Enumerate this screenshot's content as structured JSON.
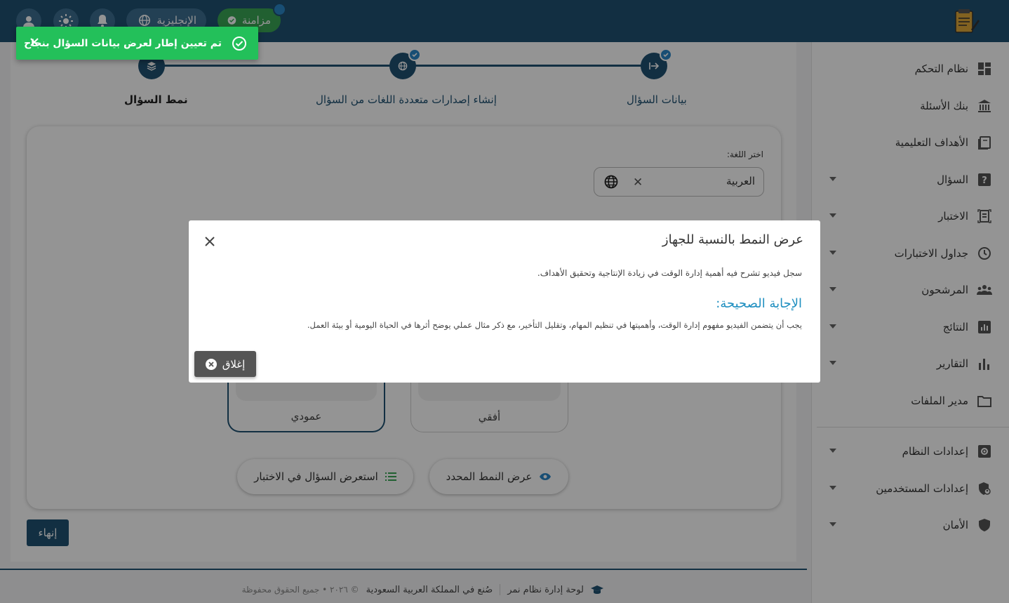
{
  "header": {
    "language_button": "الإنجليزية",
    "sync_button": "مزامنة"
  },
  "sidebar": {
    "items": [
      {
        "label": "نظام التحكم",
        "icon": "dashboard-icon"
      },
      {
        "label": "بنك الأسئلة",
        "icon": "bank-icon"
      },
      {
        "label": "الأهداف التعليمية",
        "icon": "book-icon"
      },
      {
        "label": "السؤال",
        "icon": "question-icon",
        "expandable": true
      },
      {
        "label": "الاختبار",
        "icon": "exam-icon",
        "expandable": true
      },
      {
        "label": "جداول الاختبارات",
        "icon": "clock-icon",
        "expandable": true
      },
      {
        "label": "المرشحون",
        "icon": "group-icon",
        "expandable": true
      },
      {
        "label": "النتائج",
        "icon": "results-icon",
        "expandable": true
      },
      {
        "label": "التقارير",
        "icon": "bar-chart-icon",
        "expandable": true
      },
      {
        "label": "مدير الملفات",
        "icon": "folder-icon"
      }
    ],
    "settings": [
      {
        "label": "إعدادات النظام",
        "icon": "settings-icon",
        "expandable": true
      },
      {
        "label": "إعدادات المستخدمين",
        "icon": "user-shield-icon",
        "expandable": true
      },
      {
        "label": "الأمان",
        "icon": "shield-icon",
        "expandable": true
      }
    ]
  },
  "stepper": {
    "steps": [
      {
        "label": "بيانات السؤال",
        "completed": true
      },
      {
        "label": "إنشاء إصدارات متعددة اللغات من السؤال",
        "completed": true
      },
      {
        "label": "نمط السؤال",
        "active": true
      }
    ]
  },
  "language": {
    "label": "اختر اللغة:",
    "value": "العربية"
  },
  "layouts": {
    "vertical": "عمودي",
    "horizontal": "أفقي"
  },
  "actions": {
    "preview_in_exam": "استعرض السؤال في الاختبار",
    "show_selected_layout": "عرض النمط المحدد",
    "finish": "إنهاء"
  },
  "footer": {
    "panel_name": "لوحة إدارة نظام نمر",
    "made_in": "صُنع في المملكة العربية السعودية",
    "rights": "© ٢٠٢٦ • جميع الحقوق محفوظة"
  },
  "modal": {
    "title": "عرض النمط بالنسبة للجهاز",
    "question": "سجل فيديو تشرح فيه أهمية إدارة الوقت في زيادة الإنتاجية وتحقيق الأهداف.",
    "answer_heading": "الإجابة الصحيحة:",
    "answer": "يجب أن يتضمن الفيديو مفهوم إدارة الوقت، وأهميتها في تنظيم المهام، وتقليل التأخير، مع ذكر مثال عملي يوضح أثرها في الحياة اليومية أو بيئة العمل.",
    "close_button": "إغلاق"
  },
  "toast": {
    "message": "تم تعيين إطار لعرض بيانات السؤال بنجاح"
  },
  "colors": {
    "primary": "#1f5273",
    "accent": "#2a87c9",
    "success": "#23c05a",
    "answer_heading": "#1f8fc0"
  }
}
